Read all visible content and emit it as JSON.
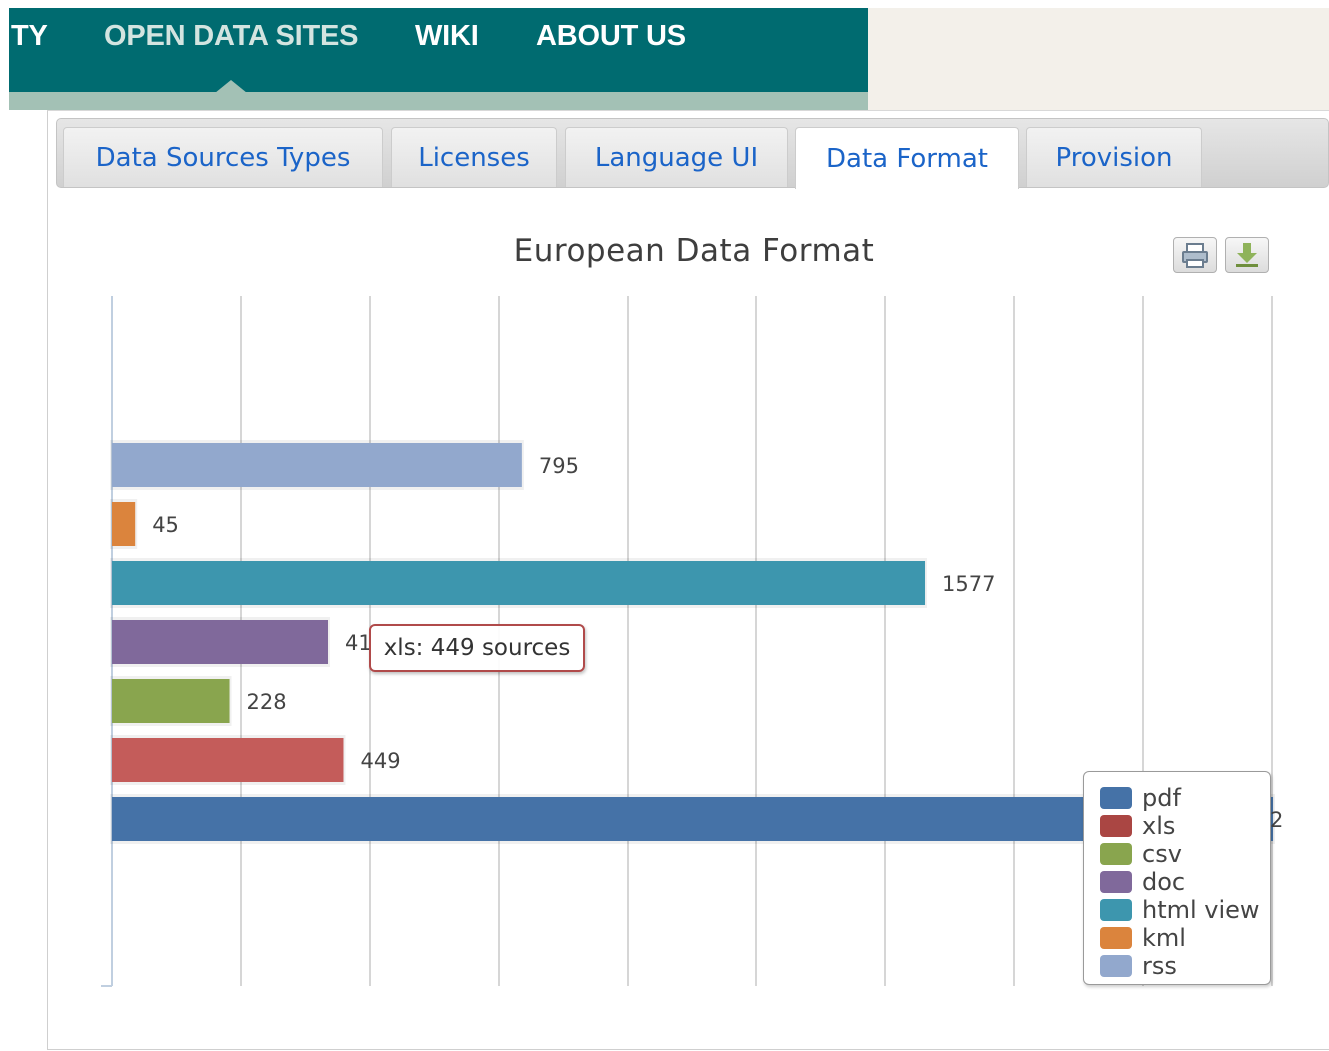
{
  "nav": {
    "items": [
      {
        "label": "TY"
      },
      {
        "label": "OPEN DATA SITES",
        "active": true
      },
      {
        "label": "WIKI"
      },
      {
        "label": "ABOUT US"
      }
    ]
  },
  "tabs": [
    {
      "label": "Data Sources Types"
    },
    {
      "label": "Licenses"
    },
    {
      "label": "Language UI"
    },
    {
      "label": "Data Format",
      "active": true
    },
    {
      "label": "Provision"
    }
  ],
  "toolbar": {
    "print_icon": "printer-icon",
    "download_icon": "download-icon"
  },
  "tooltip": {
    "text": "xls: 449 sources"
  },
  "colors": {
    "nav_bg": "#006b70",
    "tab_text": "#1b64c8",
    "tooltip_border": "#b04a4a"
  },
  "chart_data": {
    "type": "bar",
    "orientation": "horizontal",
    "title": "European Data Format",
    "xlim": [
      0,
      2250
    ],
    "grid": true,
    "legend": "bottom-right",
    "series": [
      {
        "name": "pdf",
        "value": 2252,
        "color": "#4572a7"
      },
      {
        "name": "xls",
        "value": 449,
        "color": "#c45c5a"
      },
      {
        "name": "csv",
        "value": 228,
        "color": "#89a54e"
      },
      {
        "name": "doc",
        "value": 419,
        "color": "#80699b"
      },
      {
        "name": "html view",
        "value": 1577,
        "color": "#3d96ae"
      },
      {
        "name": "kml",
        "value": 45,
        "color": "#db843d"
      },
      {
        "name": "rss",
        "value": 795,
        "color": "#92a8cd"
      }
    ],
    "value_labels": {
      "pdf": "2",
      "xls": "449",
      "csv": "228",
      "doc": "41",
      "html view": "1577",
      "kml": "45",
      "rss": "795"
    },
    "legend_colors": {
      "pdf": "#4572a7",
      "xls": "#aa4643",
      "csv": "#89a54e",
      "doc": "#80699b",
      "html view": "#3d96ae",
      "kml": "#db843d",
      "rss": "#92a8cd"
    }
  }
}
